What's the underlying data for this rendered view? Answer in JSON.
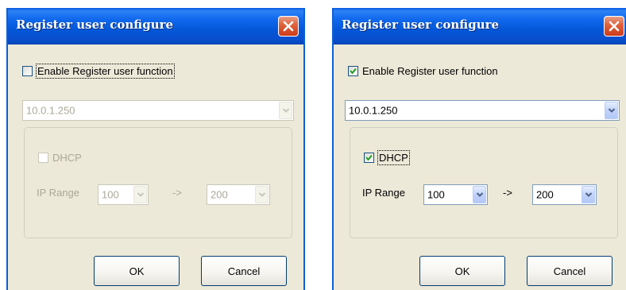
{
  "dialogs": [
    {
      "state": "disabled",
      "title": "Register user configure",
      "enable_label": "Enable Register user function",
      "enable_checked": false,
      "server_value": "10.0.1.250",
      "dhcp_label": "DHCP",
      "dhcp_checked": false,
      "ip_range_label": "IP Range",
      "range_start": "100",
      "range_arrow": "->",
      "range_end": "200",
      "ok_label": "OK",
      "cancel_label": "Cancel"
    },
    {
      "state": "enabled",
      "title": "Register user configure",
      "enable_label": "Enable Register user function",
      "enable_checked": true,
      "server_value": "10.0.1.250",
      "dhcp_label": "DHCP",
      "dhcp_checked": true,
      "ip_range_label": "IP Range",
      "range_start": "100",
      "range_arrow": "->",
      "range_end": "200",
      "ok_label": "OK",
      "cancel_label": "Cancel"
    }
  ],
  "icons": {
    "close": "close-icon",
    "checkmark": "checkmark-icon",
    "dropdown": "chevron-down-icon"
  },
  "colors": {
    "titlebar": "#0a58e0",
    "dialog_face": "#ece9d8",
    "close_button": "#e0643c",
    "check_green": "#21a121",
    "disabled_text": "#aca899",
    "input_border": "#7f9db9"
  }
}
